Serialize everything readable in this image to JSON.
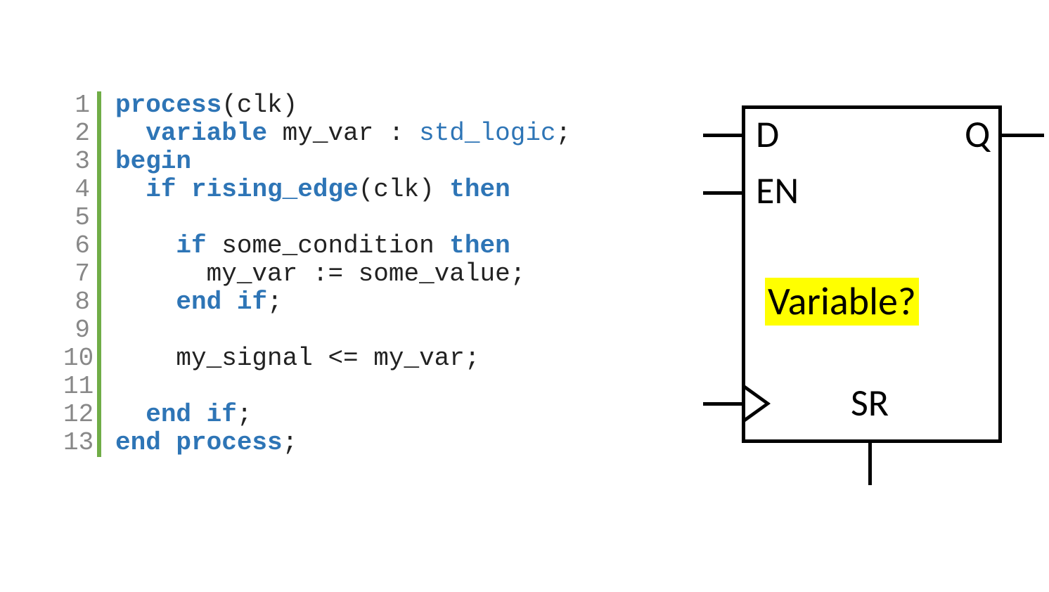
{
  "code": {
    "lines": [
      {
        "n": "1",
        "html": "<span class='kw'>process</span>(clk)"
      },
      {
        "n": "2",
        "html": "  <span class='kw'>variable</span> my_var : <span class='ty'>std_logic</span>;"
      },
      {
        "n": "3",
        "html": "<span class='kw'>begin</span>"
      },
      {
        "n": "4",
        "html": "  <span class='kw'>if</span> <span class='fn'>rising_edge</span>(clk) <span class='kw'>then</span>"
      },
      {
        "n": "5",
        "html": ""
      },
      {
        "n": "6",
        "html": "    <span class='kw'>if</span> some_condition <span class='kw'>then</span>"
      },
      {
        "n": "7",
        "html": "      my_var := some_value;"
      },
      {
        "n": "8",
        "html": "    <span class='kw'>end if</span>;"
      },
      {
        "n": "9",
        "html": ""
      },
      {
        "n": "10",
        "html": "    my_signal <= my_var;"
      },
      {
        "n": "11",
        "html": ""
      },
      {
        "n": "12",
        "html": "  <span class='kw'>end if</span>;"
      },
      {
        "n": "13",
        "html": "<span class='kw'>end process</span>;"
      }
    ]
  },
  "flipflop": {
    "d_label": "D",
    "q_label": "Q",
    "en_label": "EN",
    "sr_label": "SR",
    "annotation": "Variable?"
  }
}
